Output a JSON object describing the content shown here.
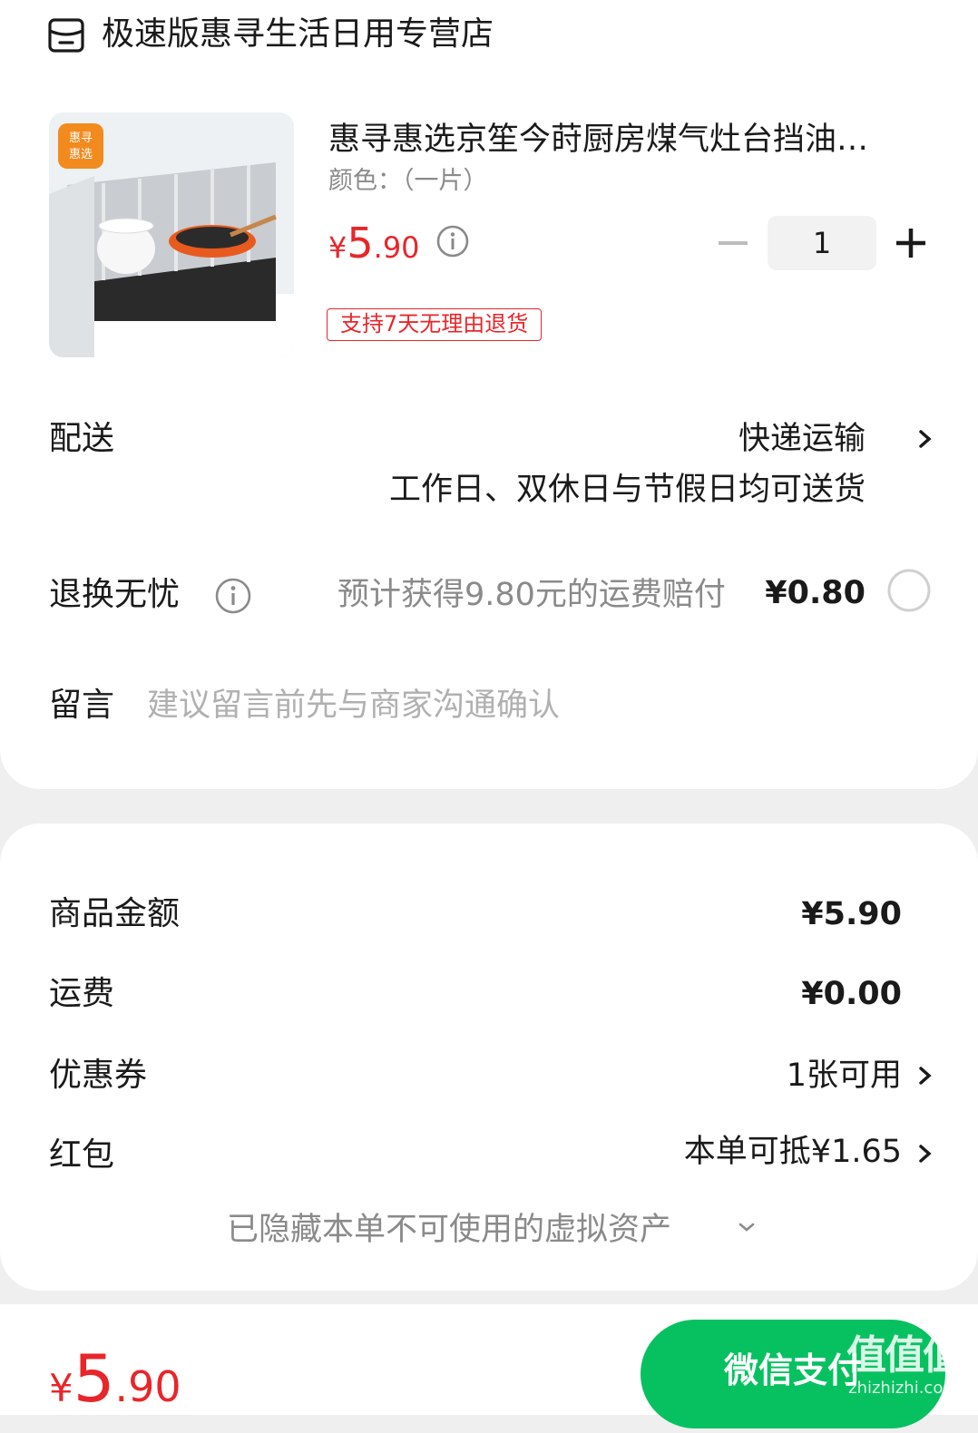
{
  "store": {
    "name": "极速版惠寻生活日用专营店",
    "icon": "store-icon"
  },
  "product": {
    "thumb_badge": "惠寻\n惠选",
    "title": "惠寻惠选京笙今莳厨房煤气灶台挡油…",
    "spec": "颜色：（一片）",
    "price_symbol": "¥",
    "price_int": "5",
    "price_dec": ".90",
    "quantity": "1",
    "return_tag": "支持7天无理由退货"
  },
  "delivery": {
    "label": "配送",
    "method": "快递运输",
    "note": "工作日、双休日与节假日均可送货"
  },
  "return_insurance": {
    "label": "退换无忧",
    "desc": "预计获得9.80元的运费赔付",
    "price": "¥0.80"
  },
  "message": {
    "label": "留言",
    "placeholder": "建议留言前先与商家沟通确认"
  },
  "summary": {
    "goods_label": "商品金额",
    "goods_value": "¥5.90",
    "shipping_label": "运费",
    "shipping_value": "¥0.00",
    "coupon_label": "优惠券",
    "coupon_value": "1张可用",
    "redpacket_label": "红包",
    "redpacket_value": "本单可抵¥1.65",
    "hidden_assets": "已隐藏本单不可使用的虚拟资产"
  },
  "footer": {
    "total_symbol": "¥",
    "total_int": "5",
    "total_dec": ".90",
    "pay_button": "微信支付"
  },
  "watermark": {
    "big": "值值值",
    "small": "zhizhizhi.com"
  },
  "colors": {
    "accent_red": "#e8262a",
    "wechat_green": "#07c160",
    "page_bg": "#efefef"
  }
}
